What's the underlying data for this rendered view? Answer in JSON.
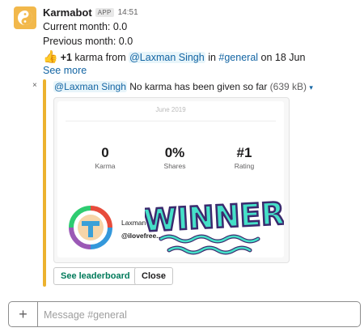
{
  "message": {
    "sender": "Karmabot",
    "app_badge": "APP",
    "time": "14:51",
    "current_month": "Current month: 0.0",
    "previous_month": "Previous month: 0.0",
    "karma_line": {
      "emoji": "👍",
      "amount": "+1",
      "text1": " karma from ",
      "mention": "@Laxman Singh",
      "text2": " in ",
      "channel": "#general",
      "text3": " on 18 Jun"
    },
    "see_more": "See more"
  },
  "attachment": {
    "mention": "@Laxman Singh",
    "title": " No karma has been given so far ",
    "size": "(639 kB)",
    "caret": "▾",
    "close_icon": "×",
    "card": {
      "month": "June 2019",
      "stats": [
        {
          "value": "0",
          "label": "Karma"
        },
        {
          "value": "0%",
          "label": "Shares"
        },
        {
          "value": "#1",
          "label": "Rating"
        }
      ],
      "user_name": "Laxman ...",
      "user_handle": "@ilovefree..",
      "sticker_text": "WINNER"
    },
    "buttons": {
      "leaderboard": "See leaderboard",
      "close": "Close"
    }
  },
  "composer": {
    "plus": "+",
    "placeholder": "Message #general"
  },
  "colors": {
    "accent_bar": "#ecb22e",
    "link": "#1264a3",
    "leaderboard_text": "#007a5a",
    "sticker": "#45e0c8"
  }
}
